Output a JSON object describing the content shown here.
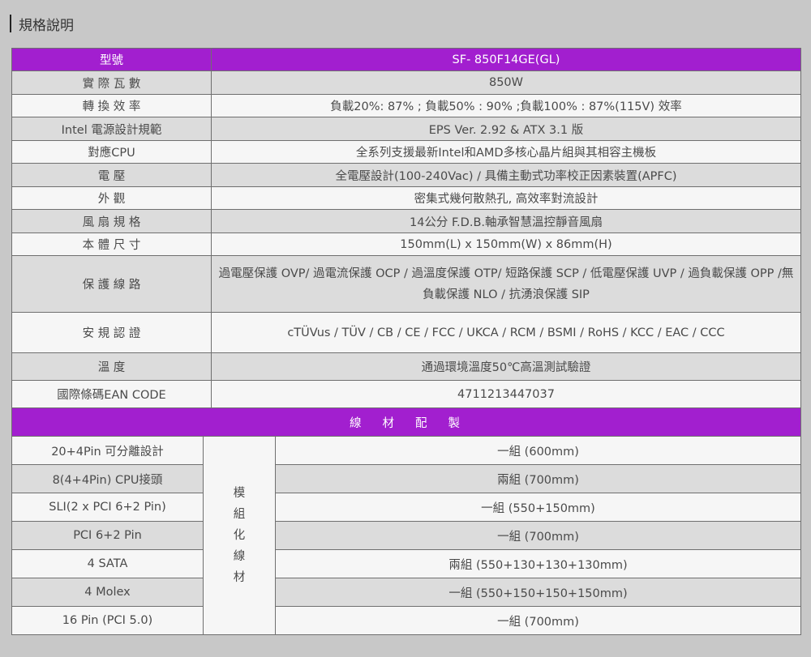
{
  "heading": "規格說明",
  "spec": {
    "header": {
      "label": "型號",
      "value": "SF- 850F14GE(GL)"
    },
    "rows": [
      {
        "label": "實 際 瓦 數",
        "value": "850W"
      },
      {
        "label": "轉 換 效 率",
        "value": "負載20%: 87% ; 負載50% : 90% ;負載100% : 87%(115V) 效率"
      },
      {
        "label": "Intel 電源設計規範",
        "value": "EPS Ver. 2.92 & ATX 3.1 版"
      },
      {
        "label": "對應CPU",
        "value": "全系列支援最新Intel和AMD多核心晶片組與其相容主機板"
      },
      {
        "label": "電 壓",
        "value": "全電壓設計(100-240Vac) / 具備主動式功率校正因素裝置(APFC)"
      },
      {
        "label": "外 觀",
        "value": "密集式幾何散熱孔, 高效率對流設計"
      },
      {
        "label": "風 扇 規 格",
        "value": "14公分 F.D.B.軸承智慧溫控靜音風扇"
      },
      {
        "label": "本 體 尺 寸",
        "value": "150mm(L) x 150mm(W) x 86mm(H)"
      },
      {
        "label": "保 護 線 路",
        "value": "過電壓保護 OVP/ 過電流保護 OCP / 過溫度保護 OTP/ 短路保護 SCP / 低電壓保護 UVP / 過負載保護 OPP /無負載保護 NLO / 抗湧浪保護 SIP"
      },
      {
        "label": "安 規 認 證",
        "value": "cTÜVus / TÜV / CB / CE / FCC / UKCA / RCM / BSMI / RoHS / KCC / EAC / CCC"
      },
      {
        "label": "溫 度",
        "value": "通過環境溫度50℃高溫測試驗證"
      },
      {
        "label": "國際條碼EAN CODE",
        "value": "4711213447037"
      }
    ]
  },
  "cable": {
    "title": "線材配製",
    "modular": "模組化線材",
    "rows": [
      {
        "connector": "20+4Pin 可分離設計",
        "spec": "一組 (600mm)"
      },
      {
        "connector": "8(4+4Pin) CPU接頭",
        "spec": "兩組 (700mm)"
      },
      {
        "connector": "SLI(2 x PCI 6+2 Pin)",
        "spec": "一組 (550+150mm)"
      },
      {
        "connector": "PCI 6+2 Pin",
        "spec": "一組 (700mm)"
      },
      {
        "connector": "4 SATA",
        "spec": "兩組 (550+130+130+130mm)"
      },
      {
        "connector": "4 Molex",
        "spec": "一組 (550+150+150+150mm)"
      },
      {
        "connector": "16 Pin (PCI 5.0)",
        "spec": "一組 (700mm)"
      }
    ]
  },
  "colors": {
    "header_purple": "#a21fcf",
    "row_white": "#f6f6f6",
    "row_gray": "#dcdcdc",
    "page_bg": "#c8c8c8"
  }
}
